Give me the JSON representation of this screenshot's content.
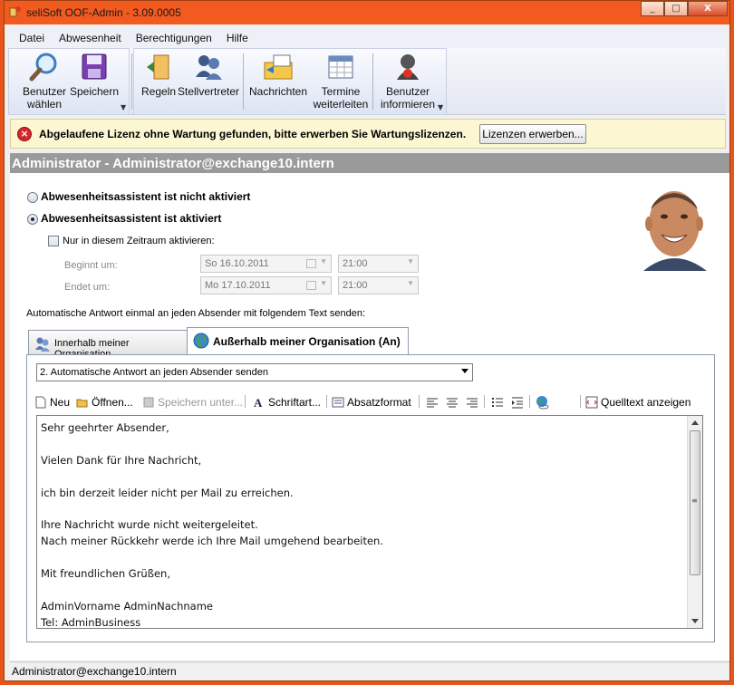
{
  "window": {
    "title": "seliSoft OOF-Admin - 3.09.0005",
    "controls": [
      "_",
      "□",
      "X"
    ]
  },
  "menu": [
    "Datei",
    "Abwesenheit",
    "Berechtigungen",
    "Hilfe"
  ],
  "toolbar": {
    "benutzer_waehlen": [
      "Benutzer",
      "wählen"
    ],
    "speichern": "Speichern",
    "regeln": "Regeln",
    "stellvertreter": "Stellvertreter",
    "nachrichten": "Nachrichten",
    "termine_weiterleiten": [
      "Termine",
      "weiterleiten"
    ],
    "benutzer_informieren": [
      "Benutzer",
      "informieren"
    ]
  },
  "warning": {
    "text": "Abgelaufene Lizenz ohne Wartung gefunden, bitte erwerben Sie Wartungslizenzen.",
    "button": "Lizenzen erwerben..."
  },
  "admin_header": "Administrator - Administrator@exchange10.intern",
  "oof": {
    "radio_inactive": "Abwesenheitsassistent ist nicht aktiviert",
    "radio_active": "Abwesenheitsassistent ist aktiviert",
    "selected": "active",
    "period_checkbox": "Nur in diesem Zeitraum aktivieren:",
    "begin_label": "Beginnt um:",
    "end_label": "Endet um:",
    "begin_date": "So 16.10.2011",
    "begin_time": "21:00",
    "end_date": "Mo 17.10.2011",
    "end_time": "21:00"
  },
  "auto_reply_info": "Automatische Antwort einmal an jeden Absender mit folgendem Text senden:",
  "tabs": {
    "internal": "Innerhalb meiner Organisation",
    "external": "Außerhalb meiner Organisation (An)"
  },
  "reply_mode": "2. Automatische Antwort an jeden Absender senden",
  "editor_toolbar": {
    "neu": "Neu",
    "oeffnen": "Öffnen...",
    "speichern_unter": "Speichern unter...",
    "schriftart": "Schriftart...",
    "absatzformat": "Absatzformat",
    "quelltext": "Quelltext anzeigen"
  },
  "message_lines": [
    "Sehr geehrter Absender,",
    "",
    "Vielen Dank für Ihre Nachricht,",
    "",
    "ich bin derzeit leider nicht per Mail zu erreichen.",
    "",
    "Ihre Nachricht wurde nicht weitergeleitet.",
    "Nach meiner Rückkehr werde ich Ihre Mail umgehend bearbeiten.",
    "",
    "Mit freundlichen Grüßen,",
    "",
    "AdminVorname AdminNachname",
    "Tel: AdminBusiness"
  ],
  "status": "Administrator@exchange10.intern",
  "colors": {
    "titlebar": "#f25a1f",
    "admin_header_bg": "#9a9a9a",
    "warning_bg": "#fcf7d2",
    "warning_icon": "#d6262a"
  }
}
